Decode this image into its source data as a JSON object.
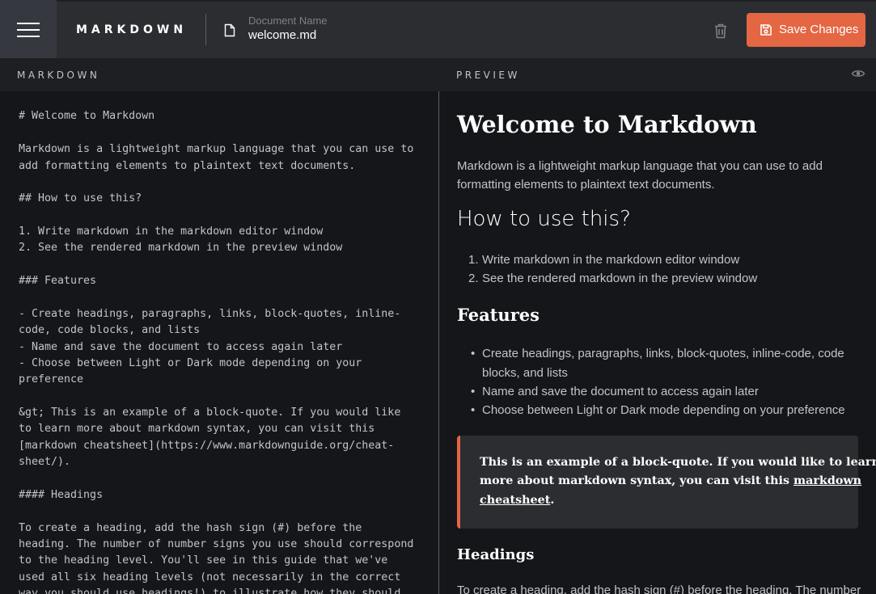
{
  "app": {
    "brand": "MARKDOWN",
    "document_label": "Document Name",
    "document_name": "welcome.md",
    "save_label": "Save Changes",
    "accent": "#e46643"
  },
  "panes": {
    "markdown_label": "MARKDOWN",
    "preview_label": "PREVIEW"
  },
  "editor": {
    "lines": [
      "# Welcome to Markdown",
      "Markdown is a lightweight markup language that you can use to",
      "add formatting elements to plaintext text documents.",
      "## How to use this?",
      "1. Write markdown in the markdown editor window",
      "2. See the rendered markdown in the preview window",
      "### Features",
      "- Create headings, paragraphs, links, block-quotes, inline-",
      "code, code blocks, and lists",
      "- Name and save the document to access again later",
      "- Choose between Light or Dark mode depending on your",
      "preference",
      "&gt; This is an example of a block-quote. If you would like",
      "to learn more about markdown syntax, you can visit this",
      "[markdown cheatsheet](https://www.markdownguide.org/cheat-",
      "sheet/).",
      "#### Headings",
      "To create a heading, add the hash sign (#) before the",
      "heading. The number of number signs you use should correspond",
      "to the heading level. You'll see in this guide that we've",
      "used all six heading levels (not necessarily in the correct",
      "way you should use headings!) to illustrate how they should"
    ]
  },
  "preview": {
    "h1": "Welcome to Markdown",
    "intro_line1": "Markdown is a lightweight markup language that you can use to add",
    "intro_line2": "formatting elements to plaintext text documents.",
    "h2": "How to use this?",
    "ordered": [
      "Write markdown in the markdown editor window",
      "See the rendered markdown in the preview window"
    ],
    "ordered_markers": [
      "1.",
      "2."
    ],
    "h3": "Features",
    "bullet_marker": "•",
    "bullets": [
      "Create headings, paragraphs, links, block-quotes, inline-code, code",
      "blocks, and lists",
      "Name and save the document to access again later",
      "Choose between Light or Dark mode depending on your preference"
    ],
    "quote_line1": "This is an example of a block-quote. If you would like to learn",
    "quote_line2_pre": "more about markdown syntax, you can visit this ",
    "quote_link1": "markdown",
    "quote_link2": "cheatsheet",
    "quote_end": ".",
    "h4": "Headings",
    "last_line": "To create a heading, add the hash sign (#) before the heading. The number"
  }
}
